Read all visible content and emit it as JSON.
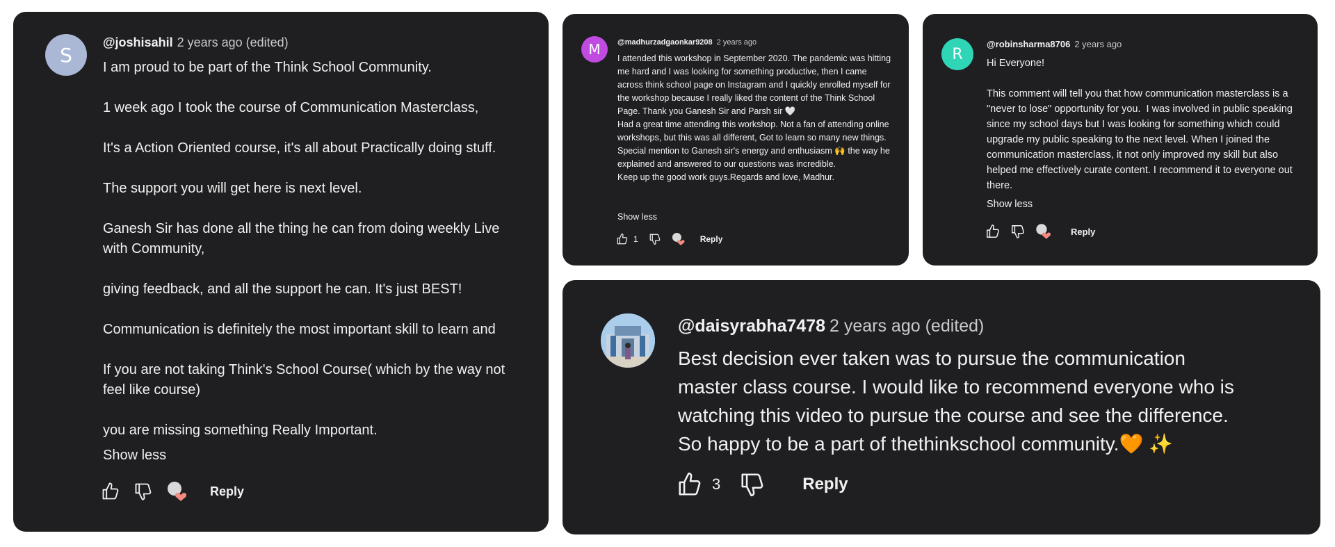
{
  "colors": {
    "card_bg": "#1f1f22",
    "heart": "#f28b82",
    "avatar_s": "#aab8d6",
    "avatar_m": "#c04be0",
    "avatar_r": "#2fd5b7"
  },
  "comments": [
    {
      "handle": "@joshisahil",
      "time": "2 years ago (edited)",
      "avatar_letter": "S",
      "text": "I am proud to be part of the Think School Community.\n\n1 week ago I took the course of Communication Masterclass,\n\nIt's a Action Oriented course, it's all about Practically doing stuff.\n\nThe support you will get here is next level.\n\nGanesh Sir has done all the thing he can from doing weekly Live with Community,\n\ngiving feedback, and all the support he can. It's just BEST!\n\nCommunication is definitely the most important skill to learn and\n\nIf you are not taking Think's School Course( which by the way not feel like course)\n\nyou are missing something Really Important.",
      "show_less": "Show less",
      "reply": "Reply"
    },
    {
      "handle": "@madhurzadgaonkar9208",
      "time": "2 years ago",
      "avatar_letter": "M",
      "text": "I attended this workshop in September 2020. The pandemic was hitting me hard and I was looking for something productive, then I came across think school page on Instagram and I quickly enrolled myself for the workshop because I really liked the content of the Think School Page. Thank you Ganesh Sir and Parsh sir 🤍\nHad a great time attending this workshop. Not a fan of attending online workshops, but this was all different, Got to learn so many new things. Special mention to Ganesh sir's energy and enthusiasm 🙌 the way he explained and answered to our questions was incredible.\nKeep up the good work guys.Regards and love, Madhur.",
      "show_less": "Show less",
      "likes": "1",
      "reply": "Reply"
    },
    {
      "handle": "@robinsharma8706",
      "time": "2 years ago",
      "avatar_letter": "R",
      "text": "Hi Everyone!\n\nThis comment will tell you that how communication masterclass is a \"never to lose\" opportunity for you.  I was involved in public speaking since my school days but I was looking for something which could upgrade my public speaking to the next level. When I joined the communication masterclass, it not only improved my skill but also helped me effectively curate content. I recommend it to everyone out there.",
      "show_less": "Show less",
      "reply": "Reply"
    },
    {
      "handle": "@daisyrabha7478",
      "time": "2 years ago (edited)",
      "text": "Best decision ever taken was to pursue the communication master class course. I would like to recommend everyone who is watching this video to pursue the course and see the difference. So happy to be a part of thethinkschool community.🧡 ✨",
      "likes": "3",
      "reply": "Reply"
    }
  ]
}
